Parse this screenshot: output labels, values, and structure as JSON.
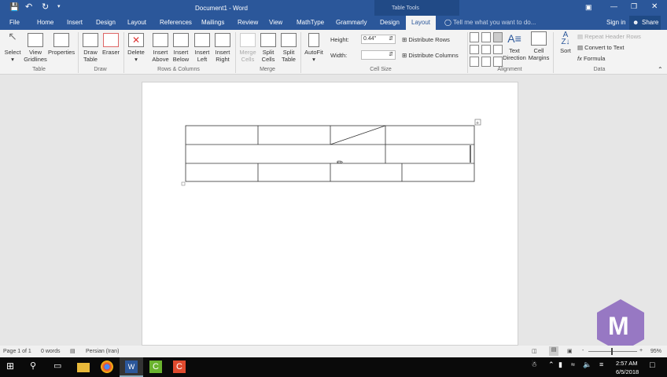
{
  "window": {
    "title": "Document1 - Word",
    "context_tab": "Table Tools",
    "sign_in": "Sign in",
    "share": "Share"
  },
  "tabs": [
    "File",
    "Home",
    "Insert",
    "Design",
    "Layout",
    "References",
    "Mailings",
    "Review",
    "View",
    "MathType",
    "Grammarly",
    "Design",
    "Layout"
  ],
  "tell_me": "Tell me what you want to do...",
  "ribbon": {
    "table": {
      "label": "Table",
      "select": "Select",
      "view_gridlines": "View Gridlines",
      "properties": "Properties"
    },
    "draw": {
      "label": "Draw",
      "draw_table": "Draw Table",
      "eraser": "Eraser"
    },
    "rows_columns": {
      "label": "Rows & Columns",
      "delete": "Delete",
      "insert_above": "Insert Above",
      "insert_below": "Insert Below",
      "insert_left": "Insert Left",
      "insert_right": "Insert Right"
    },
    "merge": {
      "label": "Merge",
      "merge_cells": "Merge Cells",
      "split_cells": "Split Cells",
      "split_table": "Split Table"
    },
    "autofit": "AutoFit",
    "cell_size": {
      "label": "Cell Size",
      "height_label": "Height:",
      "height_value": "0.44\"",
      "width_label": "Width:",
      "width_value": "",
      "distribute_rows": "Distribute Rows",
      "distribute_columns": "Distribute Columns"
    },
    "alignment": {
      "label": "Alignment",
      "text_direction": "Text Direction",
      "cell_margins": "Cell Margins"
    },
    "data": {
      "label": "Data",
      "sort": "Sort",
      "repeat_header_rows": "Repeat Header Rows",
      "convert_to_text": "Convert to Text",
      "formula": "Formula"
    }
  },
  "status": {
    "page": "Page 1 of 1",
    "words": "0 words",
    "language": "Persian (Iran)",
    "zoom": "95%"
  },
  "taskbar": {
    "time": "2:57 AM",
    "date": "6/5/2018"
  },
  "colors": {
    "accent": "#2b579a",
    "logo": "#8e6bbf"
  }
}
